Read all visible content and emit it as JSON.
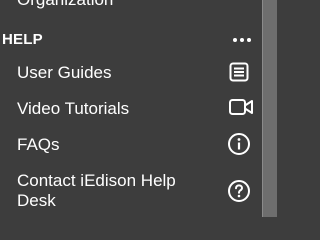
{
  "previous_item": {
    "label": "Organization"
  },
  "help_section": {
    "title": "HELP",
    "more_icon": "ellipsis-icon",
    "items": [
      {
        "label": "User Guides",
        "icon": "document-lines-icon"
      },
      {
        "label": "Video Tutorials",
        "icon": "video-camera-icon"
      },
      {
        "label": "FAQs",
        "icon": "info-circle-icon"
      },
      {
        "label": "Contact iEdison Help Desk",
        "icon": "question-circle-icon"
      }
    ]
  },
  "colors": {
    "sidebar_background": "#3d3d3d",
    "text": "#ffffff",
    "scrollbar": "#6e6e6e"
  }
}
